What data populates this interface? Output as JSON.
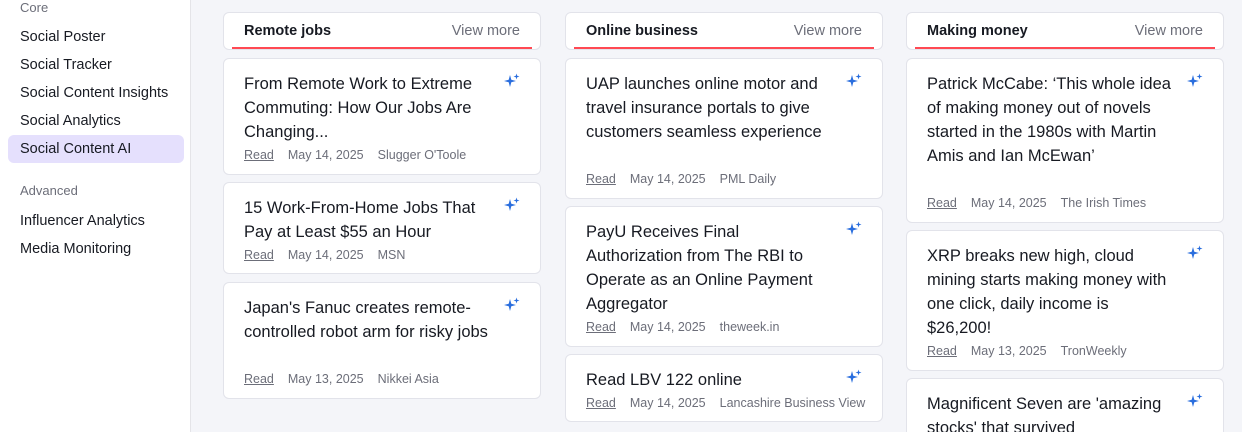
{
  "sidebar": {
    "groups": [
      {
        "title": "Core",
        "items": [
          {
            "label": "Social Poster"
          },
          {
            "label": "Social Tracker"
          },
          {
            "label": "Social Content Insights"
          },
          {
            "label": "Social Analytics"
          },
          {
            "label": "Social Content AI"
          }
        ]
      },
      {
        "title": "Advanced",
        "items": [
          {
            "label": "Influencer Analytics"
          },
          {
            "label": "Media Monitoring"
          }
        ]
      }
    ]
  },
  "columns": [
    {
      "title": "Remote jobs",
      "more": "View more",
      "cards": [
        {
          "title": "From Remote Work to Extreme Commuting: How Our Jobs Are Changing...",
          "read": "Read",
          "date": "May 14, 2025",
          "source": "Slugger O'Toole"
        },
        {
          "title": "15 Work-From-Home Jobs That Pay at Least $55 an Hour",
          "read": "Read",
          "date": "May 14, 2025",
          "source": "MSN"
        },
        {
          "title": "Japan's Fanuc creates remote-controlled robot arm for risky jobs",
          "read": "Read",
          "date": "May 13, 2025",
          "source": "Nikkei Asia"
        }
      ]
    },
    {
      "title": "Online business",
      "more": "View more",
      "cards": [
        {
          "title": "UAP launches online motor and travel insurance portals to give customers seamless experience",
          "read": "Read",
          "date": "May 14, 2025",
          "source": "PML Daily"
        },
        {
          "title": "PayU Receives Final Authorization from The RBI to Operate as an Online Payment Aggregator",
          "read": "Read",
          "date": "May 14, 2025",
          "source": "theweek.in"
        },
        {
          "title": "Read LBV 122 online",
          "read": "Read",
          "date": "May 14, 2025",
          "source": "Lancashire Business View"
        }
      ]
    },
    {
      "title": "Making money",
      "more": "View more",
      "cards": [
        {
          "title": "Patrick McCabe: ‘This whole idea of making money out of novels started in the 1980s with Martin Amis and Ian McEwan’",
          "read": "Read",
          "date": "May 14, 2025",
          "source": "The Irish Times"
        },
        {
          "title": "XRP breaks new high, cloud mining starts making money with one click, daily income is $26,200!",
          "read": "Read",
          "date": "May 13, 2025",
          "source": "TronWeekly"
        },
        {
          "title": "Magnificent Seven are 'amazing stocks' that survived",
          "read": "",
          "date": "",
          "source": ""
        }
      ]
    }
  ],
  "colors": {
    "accent_underline": "#ff4953",
    "active_item_bg": "#e5e0fd",
    "ai_icon": "#2a6ede"
  },
  "icons": {
    "ai": "sparkle-icon"
  }
}
